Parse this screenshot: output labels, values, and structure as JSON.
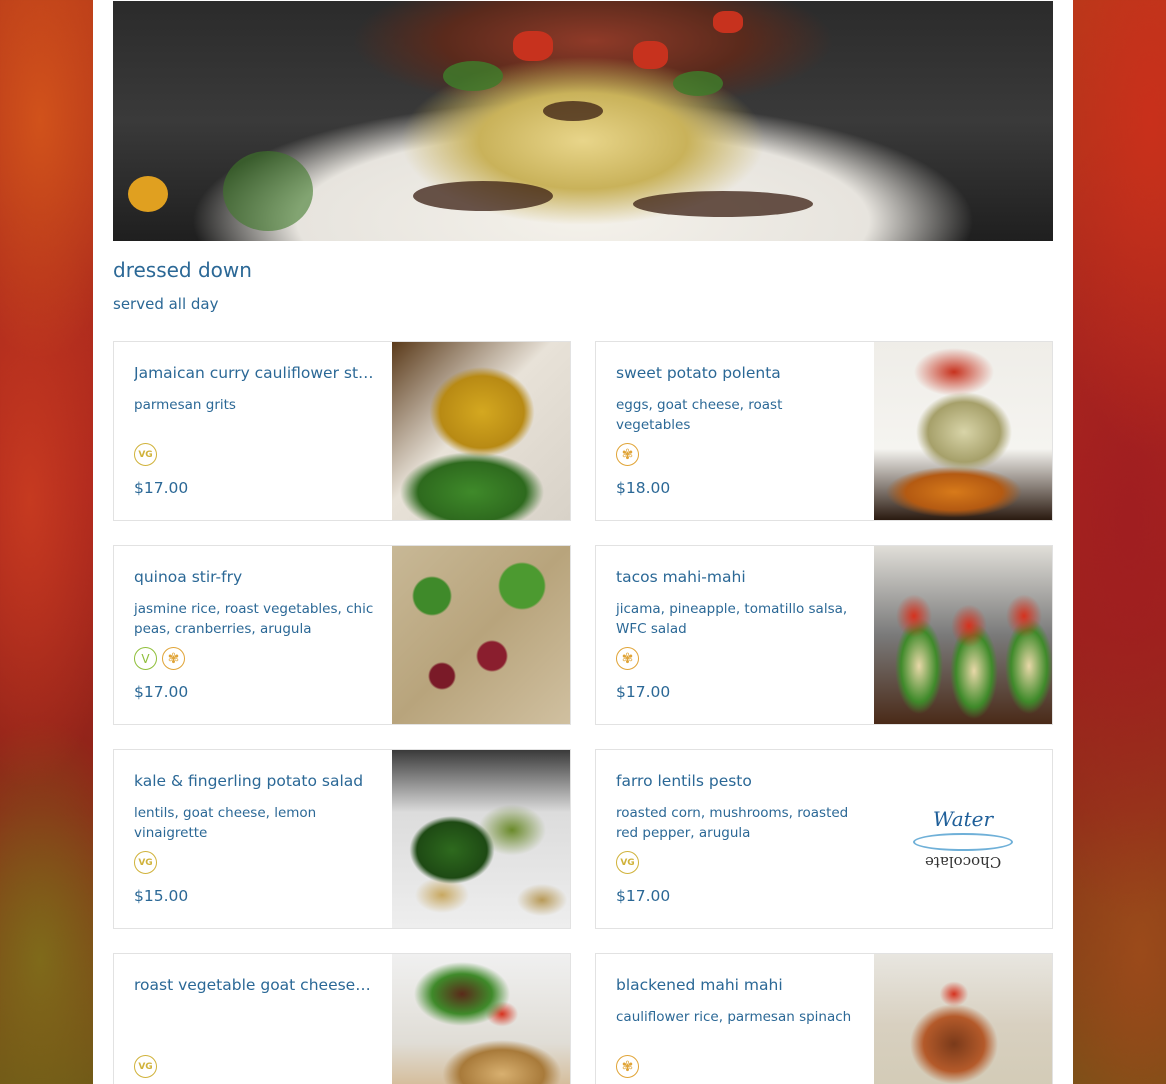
{
  "hero": {
    "image": "hero-dish-photo"
  },
  "section": {
    "title": "dressed down",
    "subtitle": "served all day"
  },
  "items": [
    {
      "name": "Jamaican curry cauliflower steak",
      "description": "parmesan grits",
      "icons": [
        "VG"
      ],
      "price": "$17.00",
      "photo": "curry-cauliflower-photo"
    },
    {
      "name": "sweet potato polenta",
      "description": "eggs, goat cheese, roast vegetables",
      "icons": [
        "GF"
      ],
      "price": "$18.00",
      "photo": "polenta-photo"
    },
    {
      "name": "quinoa stir-fry",
      "description": "jasmine rice, roast vegetables, chic peas, cranberries, arugula",
      "icons": [
        "V",
        "GF"
      ],
      "price": "$17.00",
      "photo": "quinoa-photo"
    },
    {
      "name": "tacos mahi-mahi",
      "description": "jicama, pineapple, tomatillo salsa, WFC salad",
      "icons": [
        "GF"
      ],
      "price": "$17.00",
      "photo": "tacos-photo"
    },
    {
      "name": "kale & fingerling potato salad",
      "description": "lentils, goat cheese, lemon vinaigrette",
      "icons": [
        "VG"
      ],
      "price": "$15.00",
      "photo": "kale-salad-photo"
    },
    {
      "name": "farro lentils pesto",
      "description": "roasted corn, mushrooms, roasted red pepper, arugula",
      "icons": [
        "VG"
      ],
      "price": "$17.00",
      "logo_top": "Water",
      "logo_bottom": "Chocolate"
    },
    {
      "name": "roast vegetable goat cheese quesadilla",
      "description": "",
      "icons": [
        "VG"
      ],
      "price": "",
      "photo": "quesadilla-photo"
    },
    {
      "name": "blackened mahi mahi",
      "description": "cauliflower rice, parmesan spinach",
      "icons": [
        "GF"
      ],
      "price": "",
      "photo": "mahi-photo"
    }
  ],
  "colors": {
    "text": "#2b6896",
    "vg_icon": "#d0b23a",
    "v_icon": "#8fbf3a",
    "gf_icon": "#e0a437"
  }
}
